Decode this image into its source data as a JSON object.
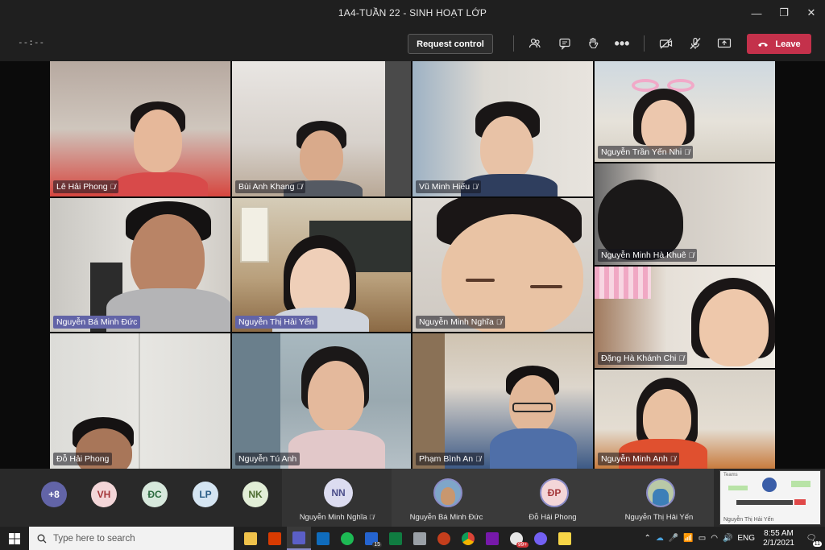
{
  "window": {
    "title": "1A4-TUẦN 22 - SINH HOẠT LỚP"
  },
  "toolbar": {
    "timer": "--:--",
    "request_control": "Request control",
    "leave": "Leave"
  },
  "tiles": [
    {
      "name": "Lê Hải Phong",
      "muted": true
    },
    {
      "name": "Bùi Anh Khang",
      "muted": true
    },
    {
      "name": "Vũ Minh Hiếu",
      "muted": true
    },
    {
      "name": "Nguyễn Trần Yến Nhi",
      "muted": true
    },
    {
      "name": "Nguyễn Minh Hà Khuê",
      "muted": true
    },
    {
      "name": "Nguyễn Bá Minh Đức",
      "muted": false
    },
    {
      "name": "Nguyễn Thị Hải Yến",
      "muted": false
    },
    {
      "name": "Nguyễn Minh Nghĩa",
      "muted": true
    },
    {
      "name": "Đặng Hà Khánh Chi",
      "muted": true
    },
    {
      "name": "Đỗ Hải Phong",
      "muted": false
    },
    {
      "name": "Nguyễn Tú Anh",
      "muted": false
    },
    {
      "name": "Phạm Bình An",
      "muted": true
    },
    {
      "name": "Nguyễn Minh Anh",
      "muted": true
    }
  ],
  "participants_bar": {
    "more": "+8",
    "avatars": [
      {
        "initials": "VH",
        "color": "#f3d6d8",
        "text_color": "#a4373a"
      },
      {
        "initials": "ĐC",
        "color": "#d7e8dc",
        "text_color": "#2b6a3f"
      },
      {
        "initials": "LP",
        "color": "#d5e5f2",
        "text_color": "#2a5d86"
      },
      {
        "initials": "NK",
        "color": "#e2eed7",
        "text_color": "#4c6b2f"
      }
    ],
    "cards": [
      {
        "initials": "NN",
        "name": "Nguyễn Minh Nghĩa",
        "muted": true
      },
      {
        "initials": "",
        "name": "Nguyễn Bá Minh Đức",
        "muted": false
      },
      {
        "initials": "ĐP",
        "name": "Đỗ Hải Phong",
        "muted": false
      },
      {
        "initials": "",
        "name": "Nguyễn Thị Hải Yến",
        "muted": false
      }
    ],
    "preview_name": "Nguyễn Thị Hải Yến",
    "preview_app": "Teams"
  },
  "taskbar": {
    "search_placeholder": "Type here to search",
    "badge_tasks": "15",
    "badge_app": "99+",
    "lang": "ENG",
    "time": "8:55 AM",
    "date": "2/1/2021",
    "notifications": "11"
  },
  "colors": {
    "accent": "#6264a7",
    "leave": "#c4314b",
    "titlebar": "#1f1f1f"
  }
}
